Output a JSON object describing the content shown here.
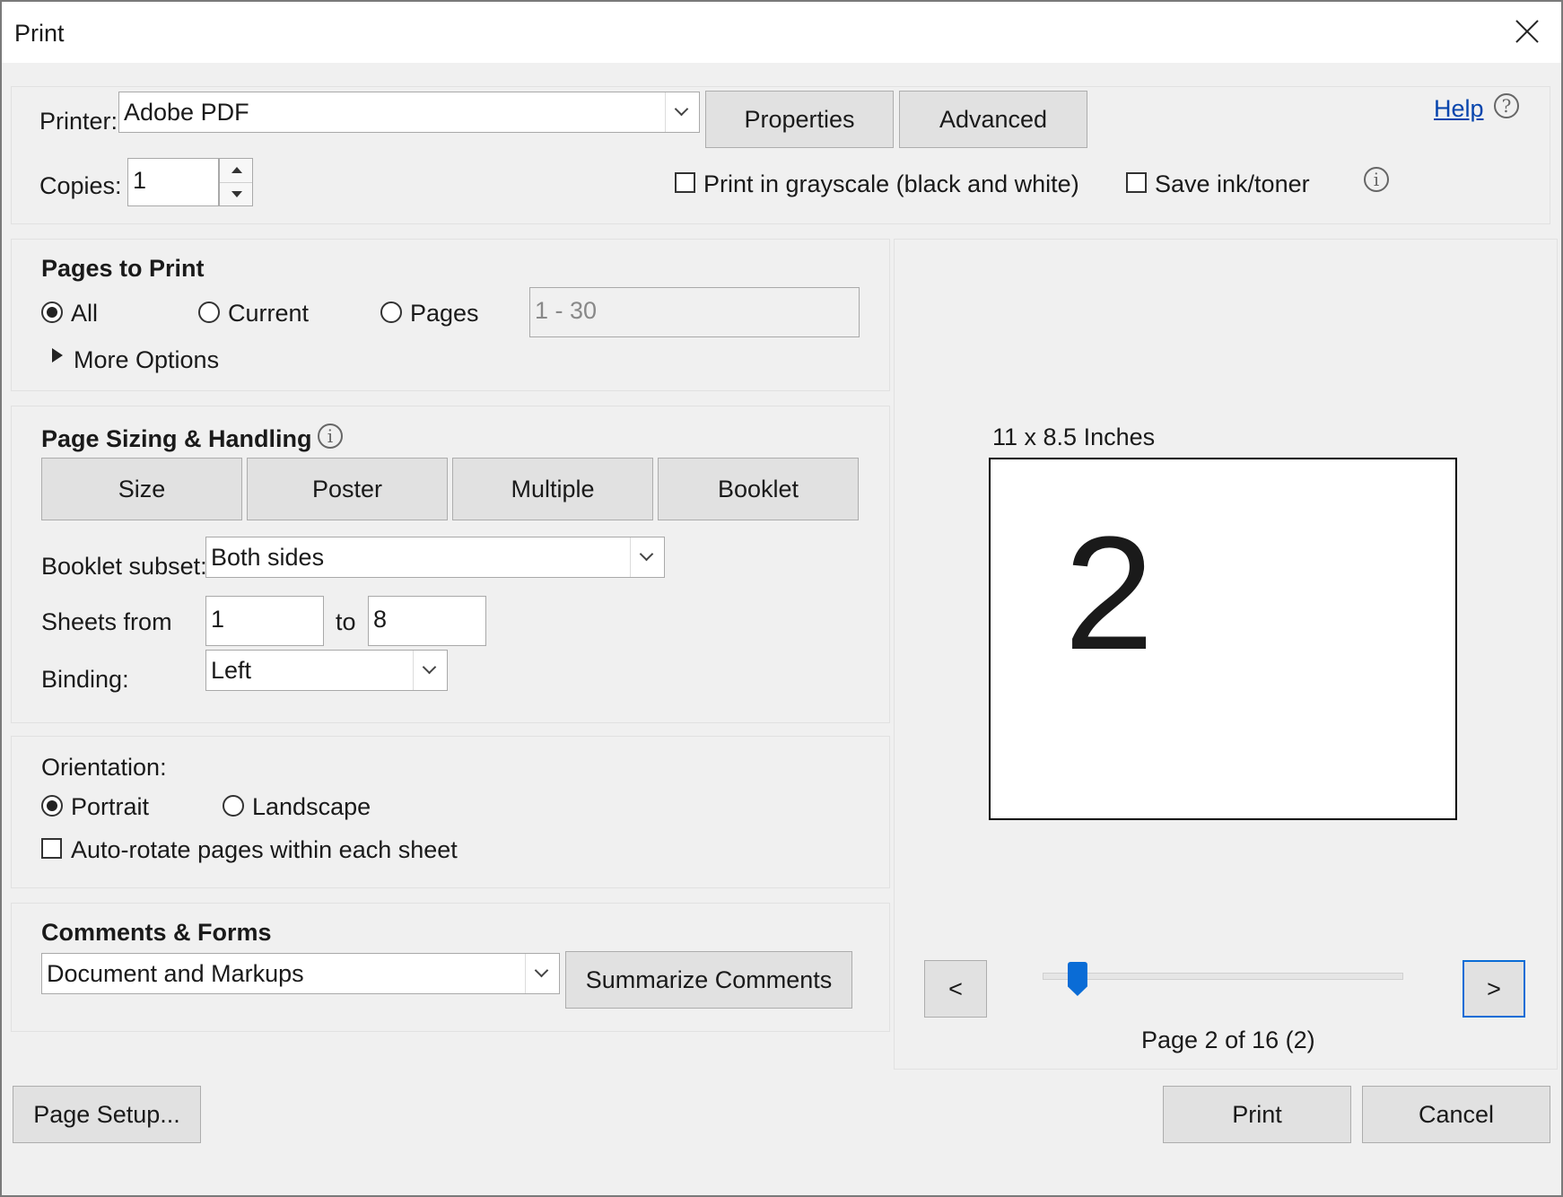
{
  "window": {
    "title": "Print"
  },
  "printer": {
    "label": "Printer:",
    "value": "Adobe PDF",
    "properties": "Properties",
    "advanced": "Advanced"
  },
  "help": {
    "label": "Help",
    "icon": "help-circle-icon"
  },
  "copies": {
    "label": "Copies:",
    "value": "1"
  },
  "options": {
    "grayscale": "Print in grayscale (black and white)",
    "save_ink": "Save ink/toner"
  },
  "pages": {
    "heading": "Pages to Print",
    "all": "All",
    "current": "Current",
    "pages": "Pages",
    "range_value": "1 - 30",
    "selected": "All",
    "more_options": "More Options"
  },
  "sizing": {
    "heading": "Page Sizing & Handling",
    "tabs": [
      "Size",
      "Poster",
      "Multiple",
      "Booklet"
    ],
    "booklet_subset_label": "Booklet subset:",
    "booklet_subset_value": "Both sides",
    "sheets_from_label": "Sheets from",
    "sheets_from": "1",
    "to_label": "to",
    "sheets_to": "8",
    "binding_label": "Binding:",
    "binding_value": "Left"
  },
  "orientation": {
    "heading": "Orientation:",
    "portrait": "Portrait",
    "landscape": "Landscape",
    "selected": "Portrait",
    "auto_rotate": "Auto-rotate pages within each sheet"
  },
  "comments": {
    "heading": "Comments & Forms",
    "value": "Document and Markups",
    "summarize": "Summarize Comments"
  },
  "preview": {
    "size_label": "11 x 8.5 Inches",
    "page_number": "2",
    "prev": "<",
    "next": ">",
    "page_status": "Page 2 of 16 (2)",
    "current_page": 2,
    "total_pages": 16
  },
  "footer": {
    "page_setup": "Page Setup...",
    "print": "Print",
    "cancel": "Cancel"
  },
  "colors": {
    "accent": "#0a6cd6",
    "link": "#0645ad"
  }
}
